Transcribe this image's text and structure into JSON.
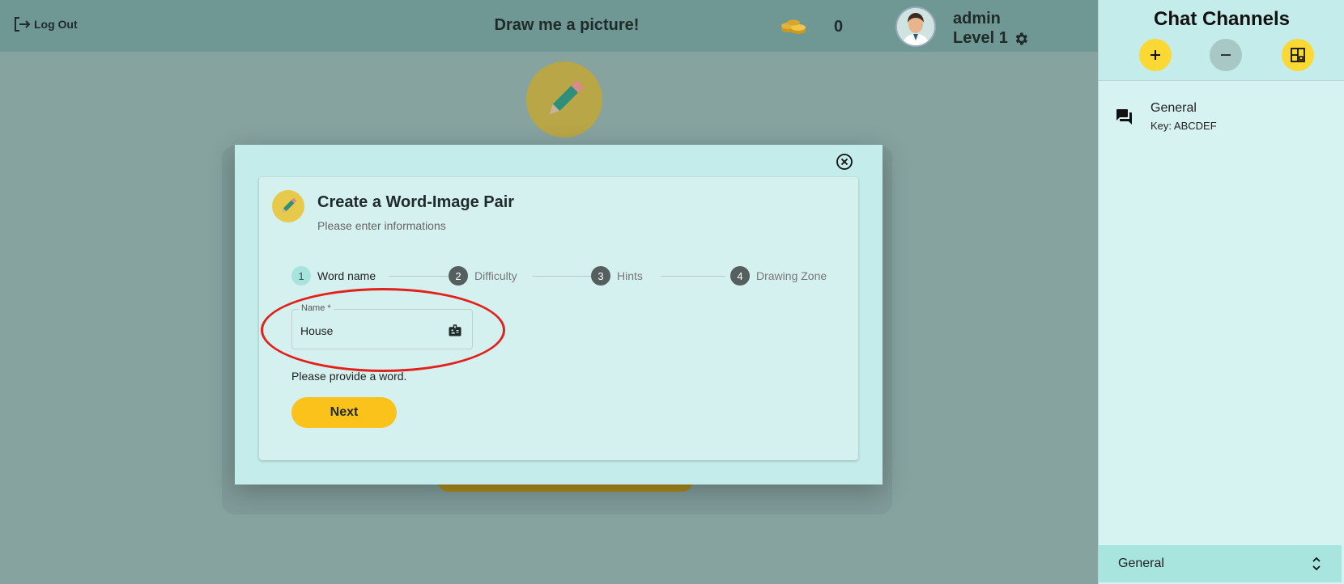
{
  "header": {
    "logout_label": "Log Out",
    "title": "Draw me a picture!",
    "coins": "0",
    "username": "admin",
    "level": "Level 1"
  },
  "modal": {
    "title": "Create a Word-Image Pair",
    "subtitle": "Please enter informations",
    "steps": [
      {
        "number": "1",
        "label": "Word name"
      },
      {
        "number": "2",
        "label": "Difficulty"
      },
      {
        "number": "3",
        "label": "Hints"
      },
      {
        "number": "4",
        "label": "Drawing Zone"
      }
    ],
    "name_field": {
      "label": "Name *",
      "value": "House"
    },
    "error_text": "Please provide a word.",
    "next_label": "Next"
  },
  "chat": {
    "title": "Chat Channels",
    "channels": [
      {
        "name": "General",
        "key": "Key: ABCDEF"
      }
    ],
    "footer_selected": "General"
  },
  "colors": {
    "accent_yellow": "#fbc21b",
    "highlight_red": "#e2211c",
    "panel_teal": "#c4ecea"
  },
  "icons": [
    "logout-icon",
    "coins-icon",
    "avatar",
    "gear-icon",
    "pencil-icon",
    "close-circle-icon",
    "badge-icon",
    "plus-icon",
    "minus-icon",
    "expand-icon",
    "chat-bubble-icon",
    "unfold-icon"
  ]
}
